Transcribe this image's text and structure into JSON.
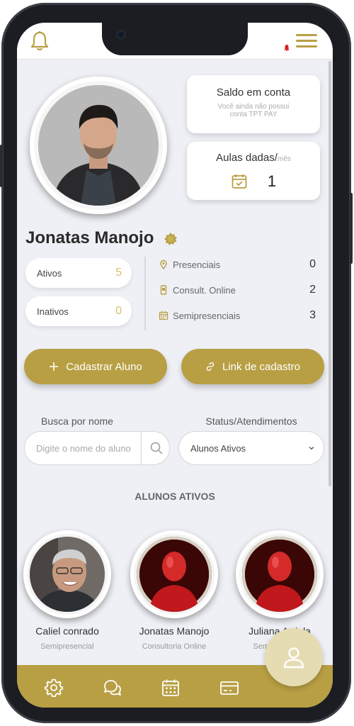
{
  "colors": {
    "accent": "#b89f44",
    "accent_light": "#d8c16c",
    "background": "#eef0f5",
    "notification": "#d32020"
  },
  "header": {
    "bell_icon": "bell-icon",
    "menu_icon": "hamburger-menu-icon"
  },
  "balance_card": {
    "title": "Saldo em conta",
    "subtitle_line1": "Você ainda não possui",
    "subtitle_line2": "conta TPT PAY"
  },
  "classes_card": {
    "title": "Aulas dadas/",
    "period": "mês",
    "count": "1",
    "icon": "calendar-check-icon"
  },
  "profile": {
    "name": "Jonatas Manojo",
    "badge_icon": "verified-badge-icon"
  },
  "counters": [
    {
      "label": "Ativos",
      "value": "5"
    },
    {
      "label": "Inativos",
      "value": "0"
    }
  ],
  "stats": [
    {
      "label": "Presenciais",
      "value": "0",
      "icon": "location-pin-icon"
    },
    {
      "label": "Consult. Online",
      "value": "2",
      "icon": "phone-icon"
    },
    {
      "label": "Semipresenciais",
      "value": "3",
      "icon": "calendar-icon"
    }
  ],
  "actions": {
    "register_student": {
      "label": "Cadastrar Aluno",
      "icon": "plus-icon"
    },
    "registration_link": {
      "label": "Link de cadastro",
      "icon": "link-icon"
    }
  },
  "search": {
    "label": "Busca por nome",
    "placeholder": "Digite o nome do aluno"
  },
  "status_filter": {
    "label": "Status/Atendimentos",
    "selected": "Alunos Ativos"
  },
  "students_section": {
    "title": "ALUNOS ATIVOS"
  },
  "students": [
    {
      "name": "Caliel conrado",
      "type": "Semipresencial"
    },
    {
      "name": "Jonatas  Manojo",
      "type": "Consultoria Online"
    },
    {
      "name": "Juliana Arriola",
      "type": "Semipresencial"
    }
  ],
  "bottom_nav": [
    {
      "icon": "settings-gear-icon"
    },
    {
      "icon": "chat-icon"
    },
    {
      "icon": "calendar-icon"
    },
    {
      "icon": "payment-card-icon"
    }
  ],
  "fab": {
    "icon": "user-profile-icon"
  }
}
